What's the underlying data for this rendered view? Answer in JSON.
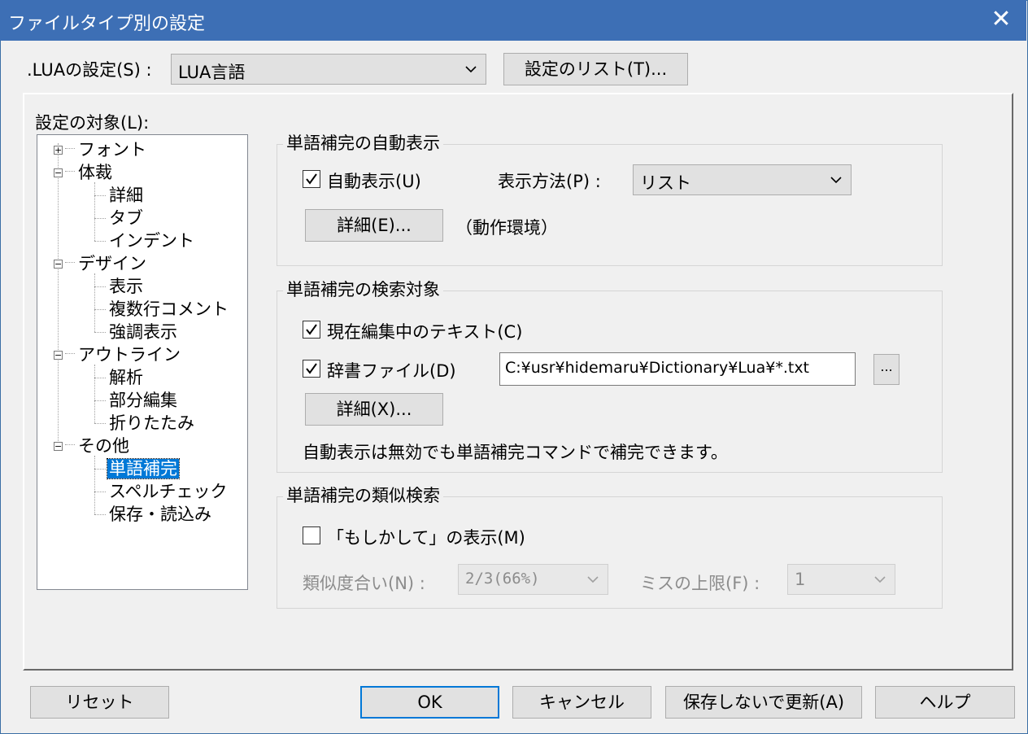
{
  "window": {
    "title": "ファイルタイプ別の設定",
    "close_glyph": "✕"
  },
  "header": {
    "lua_label": ".LUAの設定(S) :",
    "lua_value": "LUA言語",
    "settings_list_button": "設定のリスト(T)..."
  },
  "tree": {
    "label": "設定の対象(L):",
    "items": [
      {
        "label": "フォント",
        "expander": "+"
      },
      {
        "label": "体裁",
        "expander": "−"
      },
      {
        "label": "詳細"
      },
      {
        "label": "タブ"
      },
      {
        "label": "インデント"
      },
      {
        "label": "デザイン",
        "expander": "−"
      },
      {
        "label": "表示"
      },
      {
        "label": "複数行コメント"
      },
      {
        "label": "強調表示"
      },
      {
        "label": "アウトライン",
        "expander": "−"
      },
      {
        "label": "解析"
      },
      {
        "label": "部分編集"
      },
      {
        "label": "折りたたみ"
      },
      {
        "label": "その他",
        "expander": "−"
      },
      {
        "label": "単語補完",
        "selected": true
      },
      {
        "label": "スペルチェック"
      },
      {
        "label": "保存・読込み"
      }
    ]
  },
  "auto_display": {
    "group_title": "単語補完の自動表示",
    "checkbox_label": "自動表示(U)",
    "checked": true,
    "method_label": "表示方法(P) :",
    "method_value": "リスト",
    "detail_button": "詳細(E)...",
    "env_note": "（動作環境）"
  },
  "search_target": {
    "group_title": "単語補完の検索対象",
    "current_text_label": "現在編集中のテキスト(C)",
    "current_text_checked": true,
    "dictionary_label": "辞書ファイル(D)",
    "dictionary_checked": true,
    "dictionary_path": "C:¥usr¥hidemaru¥Dictionary¥Lua¥*.txt",
    "browse_button": "...",
    "detail_button": "詳細(X)...",
    "note": "自動表示は無効でも単語補完コマンドで補完できます。"
  },
  "similar_search": {
    "group_title": "単語補完の類似検索",
    "maybe_label": "「もしかして」の表示(M)",
    "maybe_checked": false,
    "similarity_label": "類似度合い(N) :",
    "similarity_value": "2/3(66%)",
    "miss_limit_label": "ミスの上限(F) :",
    "miss_limit_value": "1"
  },
  "footer": {
    "reset": "リセット",
    "ok": "OK",
    "cancel": "キャンセル",
    "update_without_save": "保存しないで更新(A)",
    "help": "ヘルプ"
  },
  "colors": {
    "titlebar": "#3d6fb5",
    "selection": "#0078d7",
    "ok_border": "#0078d7"
  }
}
